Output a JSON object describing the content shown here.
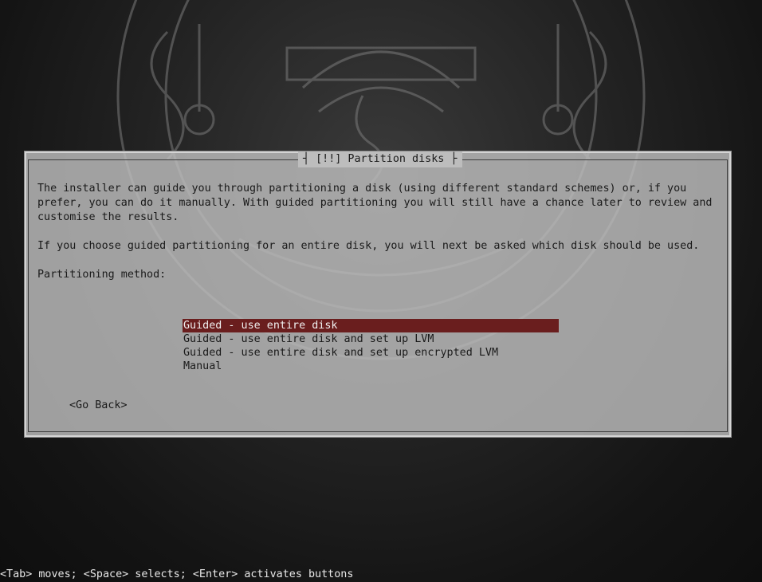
{
  "dialog": {
    "title": "[!!] Partition disks",
    "paragraphs": [
      "The installer can guide you through partitioning a disk (using different standard schemes) or, if you prefer, you can do it manually. With guided partitioning you will still have a chance later to review and customise the results.",
      "If you choose guided partitioning for an entire disk, you will next be asked which disk should be used."
    ],
    "method_label": "Partitioning method:",
    "options": [
      "Guided - use entire disk",
      "Guided - use entire disk and set up LVM",
      "Guided - use entire disk and set up encrypted LVM",
      "Manual"
    ],
    "selected_index": 0,
    "go_back_label": "<Go Back>"
  },
  "status_bar": {
    "text": "<Tab> moves; <Space> selects; <Enter> activates buttons"
  },
  "colors": {
    "selection": "#6a1e1e",
    "dialog_bg": "#bebebe",
    "screen_bg": "#121212"
  },
  "icons": {
    "background": "seal-emblem-icon"
  }
}
